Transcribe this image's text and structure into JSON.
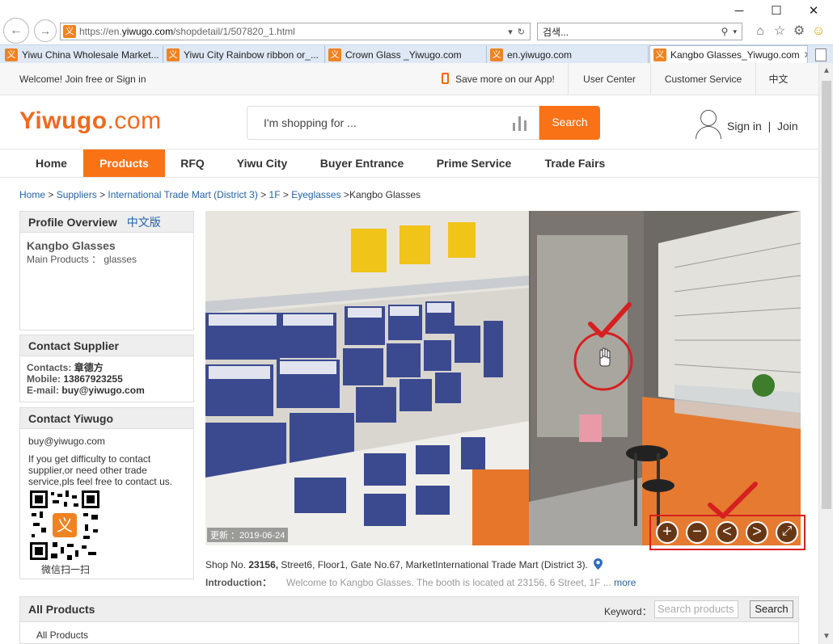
{
  "browser": {
    "url_prefix": "https://en.",
    "url_host": "yiwugo.com",
    "url_path": "/shopdetail/1/507820_1.html",
    "search_text": "검색...",
    "tabs": [
      {
        "label": "Yiwu China Wholesale Market..."
      },
      {
        "label": "Yiwu City Rainbow ribbon or_..."
      },
      {
        "label": "Crown Glass _Yiwugo.com"
      },
      {
        "label": "en.yiwugo.com"
      },
      {
        "label": "Kangbo Glasses_Yiwugo.com",
        "active": true
      }
    ]
  },
  "topbar": {
    "welcome": "Welcome! Join free or Sign in",
    "app": "Save more on our App!",
    "user_center": "User Center",
    "customer_service": "Customer Service",
    "lang": "中文"
  },
  "header": {
    "logo_main": "Yiwugo",
    "logo_tld": ".com",
    "search_placeholder": "I'm shopping for ...",
    "search_button": "Search",
    "sign_in": "Sign in",
    "sep": "|",
    "join": "Join"
  },
  "nav": [
    "Home",
    "Products",
    "RFQ",
    "Yiwu City",
    "Buyer Entrance",
    "Prime Service",
    "Trade Fairs"
  ],
  "breadcrumb": {
    "home": "Home",
    "suppliers": "Suppliers",
    "mart": "International Trade Mart (District 3)",
    "floor": "1F",
    "category": "Eyeglasses",
    "current": "Kangbo Glasses",
    "sep": " > "
  },
  "profile": {
    "title": "Profile Overview",
    "cn": "中文版",
    "name": "Kangbo Glasses",
    "main_products": "Main Products ： glasses"
  },
  "contact_supplier": {
    "title": "Contact Supplier",
    "contacts_label": "Contacts:",
    "contacts": "章德方",
    "mobile_label": "Mobile:",
    "mobile": "13867923255",
    "email_label": "E-mail:",
    "email": "buy@yiwugo.com"
  },
  "contact_yiwugo": {
    "title": "Contact Yiwugo",
    "email": "buy@yiwugo.com",
    "note": "If you get difficulty to contact supplier,or need other trade service,pls feel free to contact us.",
    "qr_caption": "微信扫一扫"
  },
  "viewer": {
    "stamp": "更新 ：2019-06-24",
    "controls": [
      {
        "name": "zoom-in",
        "glyph": "+"
      },
      {
        "name": "zoom-out",
        "glyph": "−"
      },
      {
        "name": "prev",
        "glyph": "<"
      },
      {
        "name": "next",
        "glyph": ">"
      },
      {
        "name": "fullscreen",
        "glyph": "⤢"
      }
    ]
  },
  "shop": {
    "pre": "Shop No. ",
    "no": "23156,",
    "rest": " Street6, Floor1, Gate No.67, MarketInternational Trade Mart (District 3).",
    "intro_label": "Introduction：",
    "intro_text": "Welcome to Kangbo Glasses. The booth is located at 23156, 6 Street, 1F ...",
    "more": "more"
  },
  "all_products": {
    "title": "All Products",
    "keyword": "Keyword：",
    "placeholder": "Search products",
    "button": "Search",
    "sub": "All Products"
  },
  "colors": {
    "brand": "#f97316",
    "link": "#2462a8",
    "highlight": "#d62020"
  }
}
